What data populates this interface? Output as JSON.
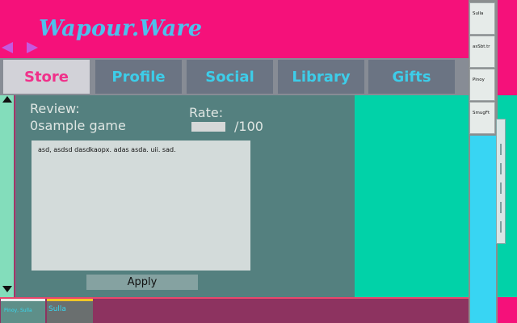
{
  "app": {
    "brand": "Wapour.Ware"
  },
  "nav": {
    "back_icon": "triangle-left-icon",
    "forward_icon": "triangle-right-icon"
  },
  "tabs": [
    {
      "label": "Store",
      "active": true
    },
    {
      "label": "Profile",
      "active": false
    },
    {
      "label": "Social",
      "active": false
    },
    {
      "label": "Library",
      "active": false
    },
    {
      "label": "Gifts",
      "active": false
    }
  ],
  "review": {
    "heading": "Review:",
    "game": "0sample game",
    "rate_label": "Rate:",
    "rate_value": "",
    "rate_max": "/100",
    "text": "asd, asdsd dasdkaopx. adas asda. uii. sad.",
    "apply_label": "Apply"
  },
  "friends": [
    {
      "name": "Sulla"
    },
    {
      "name": "asSbt.tr"
    },
    {
      "name": "Pinoy"
    },
    {
      "name": "SmugFt"
    }
  ],
  "chats": [
    {
      "label": "Pinoy, Sulla"
    },
    {
      "label": "Sulla"
    }
  ],
  "colors": {
    "background": "#f5117a",
    "brand": "#4ec0ec",
    "panel": "#54807f",
    "accent_teal": "#01d2a8",
    "active_tab_text": "#f0318a",
    "tab_text": "#3dcde9"
  }
}
